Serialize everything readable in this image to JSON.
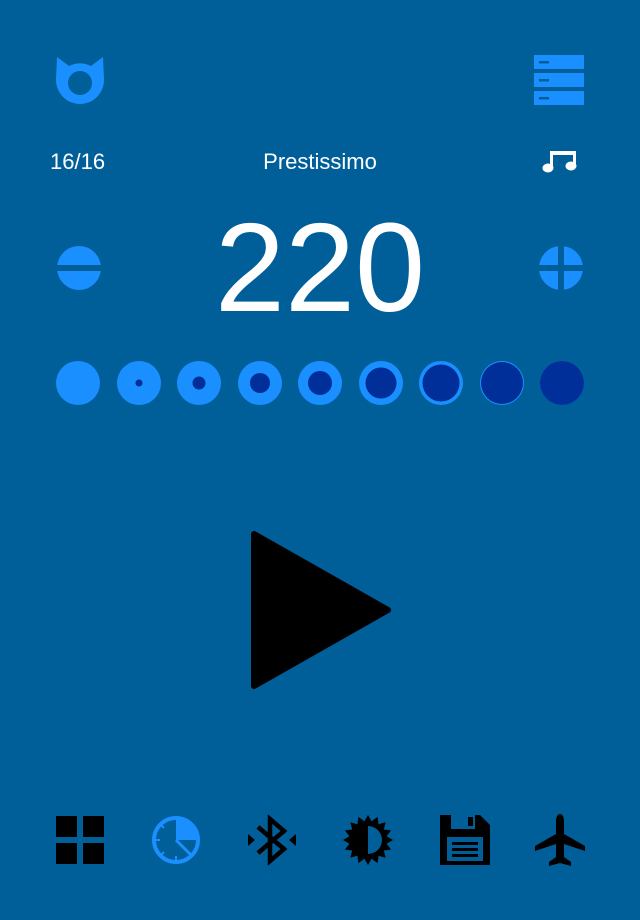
{
  "colors": {
    "background": "#005f99",
    "accent": "#1a8fff",
    "accent_dark": "#002f9a",
    "text": "#ffffff",
    "toolbar_icon": "#000000"
  },
  "header": {
    "logo_icon": "cat-face-icon",
    "menu_icon": "list-menu-icon"
  },
  "info_bar": {
    "beat_count": "16/16",
    "tempo_name": "Prestissimo",
    "sound_icon": "music-notes-icon"
  },
  "tempo": {
    "bpm": "220",
    "decrease_icon": "minus-circle-icon",
    "increase_icon": "plus-circle-icon"
  },
  "accent_levels": [
    0,
    0.15,
    0.3,
    0.45,
    0.55,
    0.7,
    0.85,
    0.95,
    1.0
  ],
  "play": {
    "icon": "play-icon"
  },
  "toolbar": {
    "items": [
      "grid-icon",
      "timer-icon",
      "bluetooth-icon",
      "brightness-icon",
      "save-icon",
      "airplane-mode-icon"
    ]
  }
}
